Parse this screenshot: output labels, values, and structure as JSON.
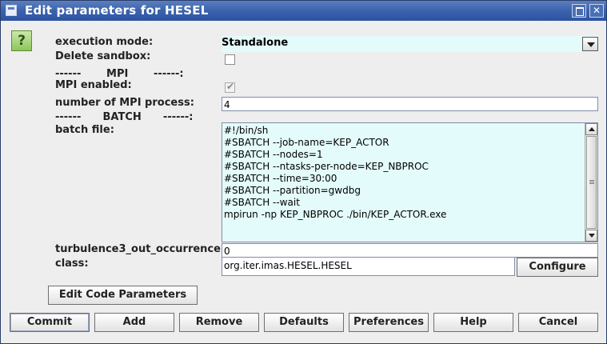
{
  "window": {
    "title": "Edit parameters for HESEL",
    "icons": {
      "app": "window-app-icon",
      "maximize": "maximize-icon",
      "close": "close-icon"
    }
  },
  "help": {
    "label": "?",
    "icon": "help-icon"
  },
  "form": {
    "execution_mode": {
      "label": "execution mode:",
      "value": "Standalone"
    },
    "delete_sandbox": {
      "label": "Delete sandbox:",
      "checked": false
    },
    "mpi_separator": "------       MPI       ------:",
    "mpi_enabled": {
      "label": "MPI enabled:",
      "checked": true,
      "mark": "✔"
    },
    "mpi_process": {
      "label": "number of MPI process:",
      "value": "4"
    },
    "batch_separator": "------      BATCH      ------:",
    "batch_file": {
      "label": "batch file:",
      "lines": [
        "#!/bin/sh",
        "#SBATCH --job-name=KEP_ACTOR",
        "#SBATCH --nodes=1",
        "#SBATCH --ntasks-per-node=KEP_NBPROC",
        "#SBATCH --time=30:00",
        "#SBATCH --partition=gwdbg",
        "#SBATCH --wait",
        "mpirun -np KEP_NBPROC ./bin/KEP_ACTOR.exe"
      ]
    },
    "turbulence": {
      "label": "turbulence3_out_occurrence:",
      "value": "0"
    },
    "class": {
      "label": "class:",
      "value": "org.iter.imas.HESEL.HESEL",
      "configure_label": "Configure"
    }
  },
  "edit_code_parameters_label": "Edit Code Parameters",
  "buttons": {
    "commit": "Commit",
    "add": "Add",
    "remove": "Remove",
    "defaults": "Defaults",
    "preferences": "Preferences",
    "help": "Help",
    "cancel": "Cancel"
  },
  "colors": {
    "titlebar": "#3a62ad",
    "field_highlight": "#e4fbfb",
    "help_green": "#8dc55c"
  }
}
